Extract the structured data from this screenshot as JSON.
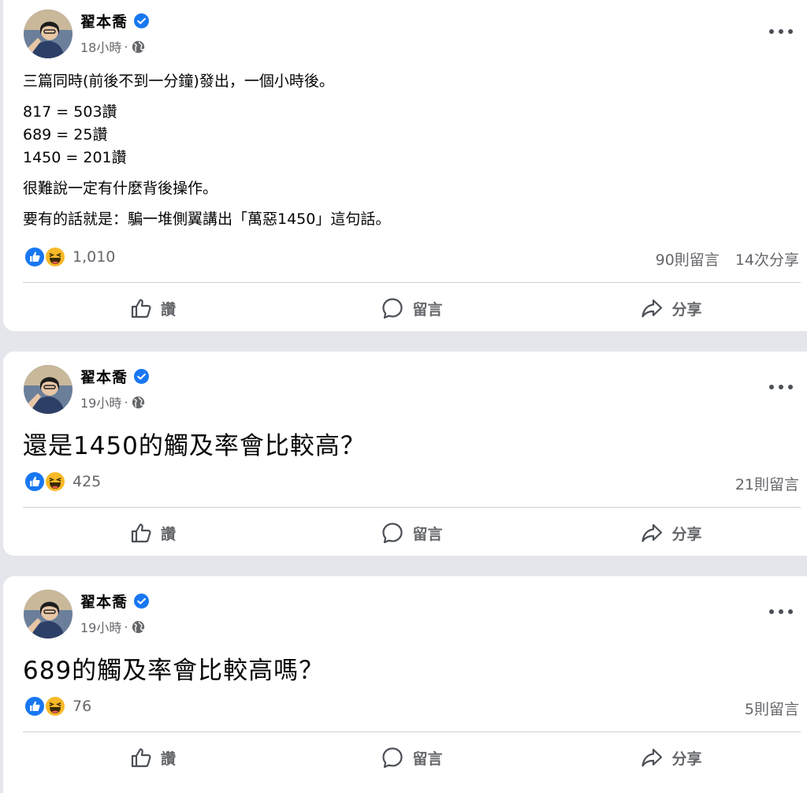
{
  "colors": {
    "page_bg": "#e4e6eb",
    "card_bg": "#ffffff",
    "secondary_text": "#65676b",
    "verified_blue": "#1877f2",
    "like_blue": "#1877f2",
    "haha_yellow": "#f7b928"
  },
  "posts": [
    {
      "author": "翟本喬",
      "verified_icon": "verified-badge-icon",
      "time": "18小時",
      "dot": "·",
      "privacy_icon": "globe-icon",
      "body": [
        "三篇同時(前後不到一分鐘)發出，一個小時後。",
        "817 = 503讚",
        "689 = 25讚",
        "1450 = 201讚",
        "很難說一定有什麼背後操作。",
        "要有的話就是：騙一堆側翼講出「萬惡1450」這句話。"
      ],
      "reactions": [
        "like-icon",
        "haha-icon"
      ],
      "reaction_count": "1,010",
      "comments": "90則留言",
      "shares": "14次分享",
      "actions": {
        "like": "讚",
        "comment": "留言",
        "share": "分享"
      }
    },
    {
      "author": "翟本喬",
      "verified_icon": "verified-badge-icon",
      "time": "19小時",
      "dot": "·",
      "privacy_icon": "globe-icon",
      "body_large": "還是1450的觸及率會比較高？",
      "reactions": [
        "like-icon",
        "haha-icon"
      ],
      "reaction_count": "425",
      "comments": "21則留言",
      "actions": {
        "like": "讚",
        "comment": "留言",
        "share": "分享"
      }
    },
    {
      "author": "翟本喬",
      "verified_icon": "verified-badge-icon",
      "time": "19小時",
      "dot": "·",
      "privacy_icon": "globe-icon",
      "body_large": "689的觸及率會比較高嗎？",
      "reactions": [
        "like-icon",
        "haha-icon"
      ],
      "reaction_count": "76",
      "comments": "5則留言",
      "actions": {
        "like": "讚",
        "comment": "留言",
        "share": "分享"
      }
    }
  ]
}
